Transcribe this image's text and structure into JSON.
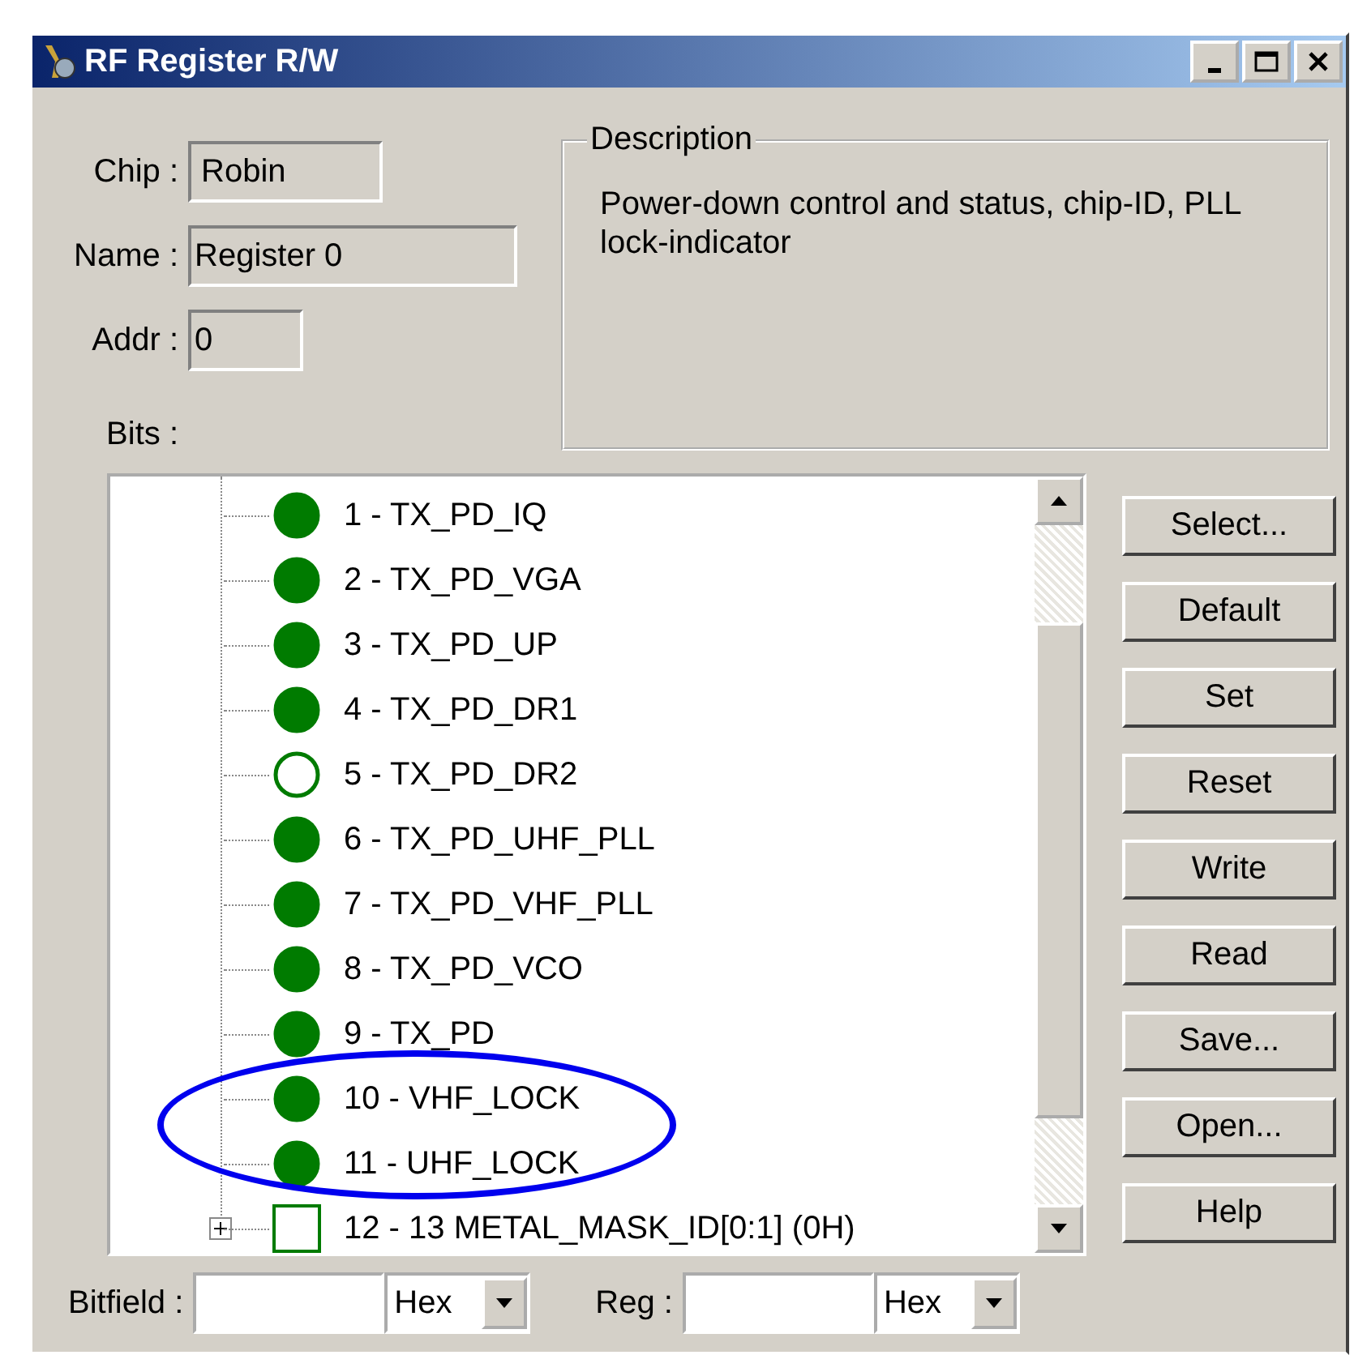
{
  "window": {
    "title": "RF Register R/W"
  },
  "fields": [
    {
      "label": "Chip :",
      "value": "Robin"
    },
    {
      "label": "Name :",
      "value": "Register 0"
    },
    {
      "label": "Addr :",
      "value": "0"
    }
  ],
  "bits_label": "Bits :",
  "description": {
    "title": "Description",
    "text": "Power-down control and status, chip-ID, PLL lock-indicator"
  },
  "bits": [
    {
      "kind": "bit",
      "label": "1 - TX_PD_IQ",
      "set": true
    },
    {
      "kind": "bit",
      "label": "2 - TX_PD_VGA",
      "set": true
    },
    {
      "kind": "bit",
      "label": "3 - TX_PD_UP",
      "set": true
    },
    {
      "kind": "bit",
      "label": "4 - TX_PD_DR1",
      "set": true
    },
    {
      "kind": "bit",
      "label": "5 - TX_PD_DR2",
      "set": false
    },
    {
      "kind": "bit",
      "label": "6 - TX_PD_UHF_PLL",
      "set": true
    },
    {
      "kind": "bit",
      "label": "7 - TX_PD_VHF_PLL",
      "set": true
    },
    {
      "kind": "bit",
      "label": "8 - TX_PD_VCO",
      "set": true
    },
    {
      "kind": "bit",
      "label": "9 - TX_PD",
      "set": true
    },
    {
      "kind": "circled_group",
      "children": [
        {
          "kind": "bit",
          "label": "10 - VHF_LOCK",
          "set": true
        },
        {
          "kind": "bit",
          "label": "11 - UHF_LOCK",
          "set": true
        }
      ]
    },
    {
      "kind": "field",
      "label": "12 - 13 METAL_MASK_ID[0:1] (0H)",
      "expanded": false
    }
  ],
  "buttons": [
    "Select...",
    "Default",
    "Set",
    "Reset",
    "Write",
    "Read",
    "Save...",
    "Open...",
    "Help"
  ],
  "bottom": [
    {
      "label": "Bitfield :",
      "format": "Hex"
    },
    {
      "label": "Reg :",
      "format": "Hex"
    }
  ]
}
